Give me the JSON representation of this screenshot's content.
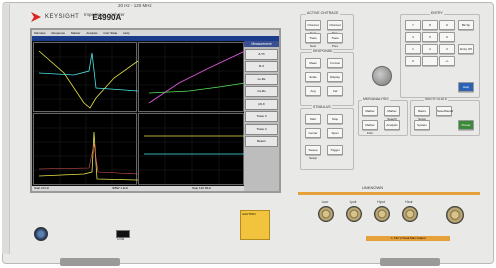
{
  "brand": {
    "name": "KEYSIGHT",
    "model": "E4990A",
    "frequency": "20 Hz - 120 MHz",
    "subtitle": "Impedance Analyzer"
  },
  "screen": {
    "menubar": [
      "Stimulus",
      "Response",
      "Marker",
      "Analysis",
      "Instr State",
      "Help"
    ],
    "titlebar": "E4990A Impedance Analyzer",
    "softmenu_title": "Measurement",
    "softkeys": [
      "Z-Th",
      "R-X",
      "Ls-Rs",
      "Cs-Rs",
      "|Z|-θ",
      "Trace 3",
      "Trace 4",
      "Return"
    ],
    "status_left": "Start 20 Hz",
    "status_right": "Stop 120 MHz",
    "status_mid": "IFBW 1 kHz"
  },
  "groups": {
    "active": "ACTIVE CH/TRACE",
    "response": "RESPONSE",
    "entry": "ENTRY",
    "stimulus": "STIMULUS",
    "marker": "MKR/ANALYSIS",
    "instr": "INSTR STATE"
  },
  "keys": {
    "channel_next": "Channel Next",
    "channel_prev": "Channel Prev",
    "trace_next": "Trace Next",
    "trace_prev": "Trace Prev",
    "meas": "Meas",
    "format": "Format",
    "scale": "Scale",
    "display": "Display",
    "avg": "Avg",
    "cal": "Cal",
    "start": "Start",
    "stop": "Stop",
    "center": "Center",
    "span": "Span",
    "sweep_setup": "Sweep Setup",
    "trigger": "Trigger",
    "marker": "Marker",
    "marker_search": "Marker Search",
    "marker_func": "Marker Fctn",
    "analysis": "Analysis",
    "macro": "Macro Setup",
    "save": "Save/Recall",
    "system": "System",
    "preset": "Preset",
    "help": "Help",
    "enter": "Entry Off",
    "bksp": "Bk Sp"
  },
  "entry_digits": [
    "7",
    "8",
    "9",
    "4",
    "5",
    "6",
    "1",
    "2",
    "3",
    "0",
    ".",
    "+/-"
  ],
  "unknown": {
    "label": "UNKNOWN",
    "ports": [
      "Lcur",
      "Lpot",
      "Hpot",
      "Hcur"
    ],
    "warning": "⚠ ±42 V Peak Max Output"
  },
  "usb": "USB",
  "caution": "CAUTION"
}
